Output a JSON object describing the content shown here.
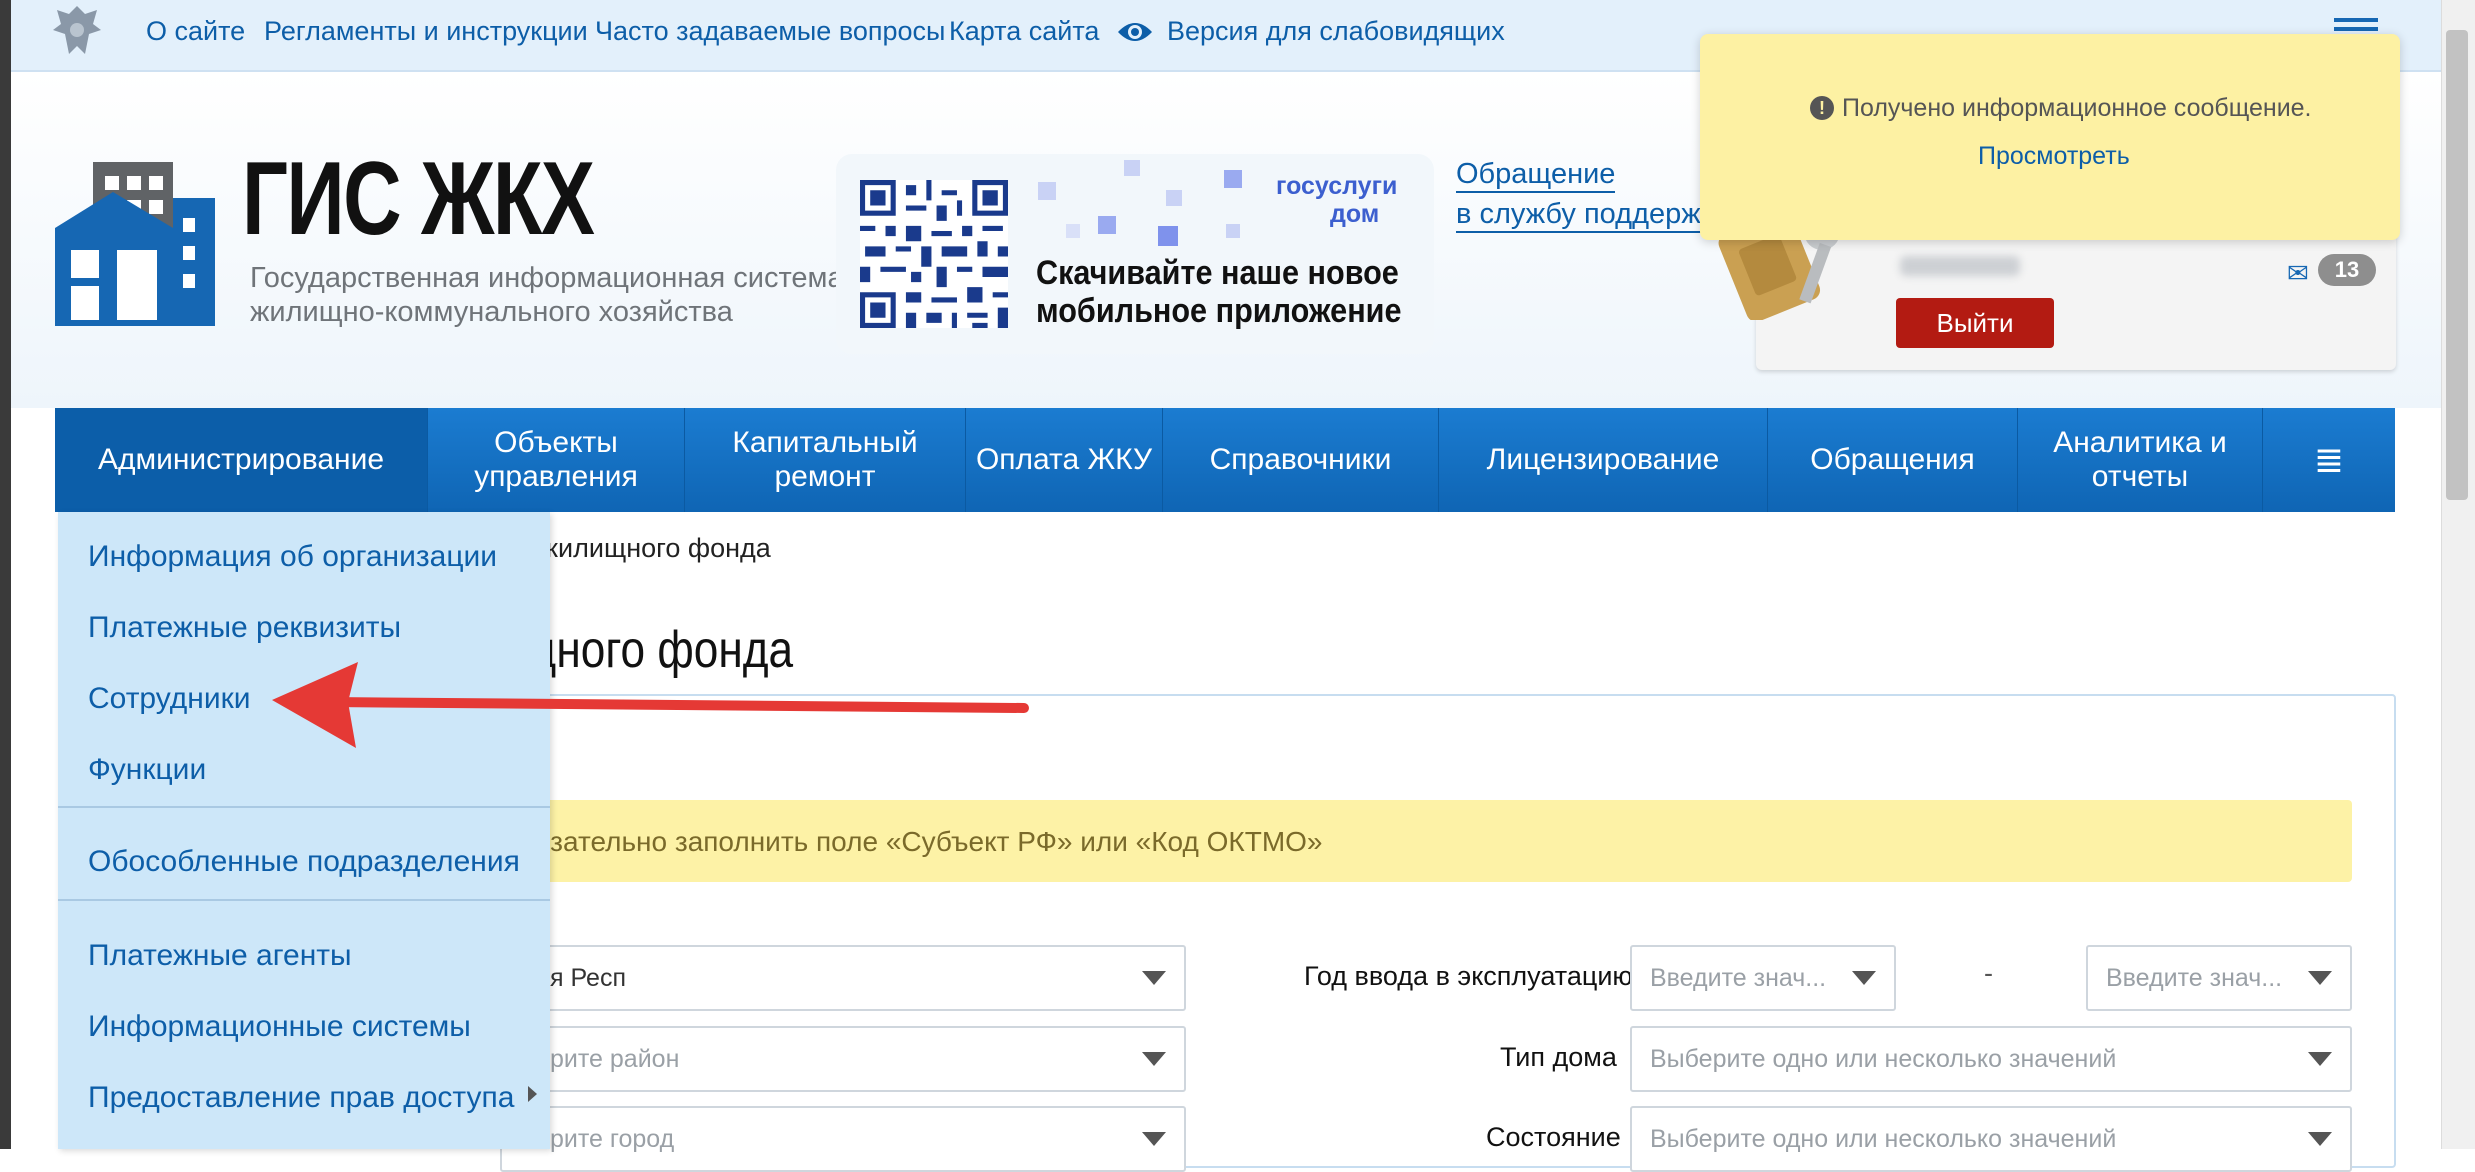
{
  "topbar": {
    "links": [
      "О сайте",
      "Регламенты и инструкции",
      "Часто задаваемые вопросы",
      "Карта сайта"
    ],
    "accessibility": "Версия для слабовидящих"
  },
  "logo": {
    "title": "ГИС ЖКХ",
    "subtitle_line1": "Государственная информационная система",
    "subtitle_line2": "жилищно-коммунального хозяйства"
  },
  "promo": {
    "brand_line1": "госуслуги",
    "brand_line2": "дом",
    "text_line1": "Скачивайте наше новое",
    "text_line2": "мобильное приложение"
  },
  "support": {
    "line1": "Обращение",
    "line2": "в службу поддержки"
  },
  "user": {
    "logout_label": "Выйти",
    "mail_count": "13"
  },
  "toast": {
    "icon": "!",
    "message": "Получено информационное сообщение.",
    "link": "Просмотреть"
  },
  "nav": {
    "items": [
      {
        "label": "Администрирование"
      },
      {
        "label": "Объекты управления"
      },
      {
        "label": "Капитальный ремонт"
      },
      {
        "label": "Оплата ЖКУ"
      },
      {
        "label": "Справочники"
      },
      {
        "label": "Лицензирование"
      },
      {
        "label": "Обращения"
      },
      {
        "label": "Аналитика и отчеты"
      }
    ],
    "menu_icon": "≣"
  },
  "dropdown": {
    "items": [
      "Информация об организации",
      "Платежные реквизиты",
      "Сотрудники",
      "Функции",
      "Обособленные подразделения",
      "Платежные агенты",
      "Информационные системы",
      "Предоставление прав доступа"
    ]
  },
  "page": {
    "breadcrumb": "жилищного фонда",
    "title": "щного фонда",
    "warning": "язательно заполнить поле «Субъект РФ» или «Код ОКТМО»",
    "fields": {
      "region_value": "я Респ",
      "district_placeholder": "рите район",
      "city_placeholder": "рите город",
      "year_label": "Год ввода в эксплуатацию",
      "year_from_placeholder": "Введите знач...",
      "year_dash": "-",
      "year_to_placeholder": "Введите знач...",
      "house_type_label": "Тип дома",
      "house_type_placeholder": "Выберите одно или несколько значений",
      "state_label": "Состояние",
      "state_placeholder": "Выберите одно или несколько значений"
    }
  },
  "colors": {
    "nav_blue": "#1570c2",
    "dropdown_bg": "#cde7f9",
    "toast_bg": "#fdf1a3",
    "logout_red": "#b31b12",
    "arrow_red": "#e53935"
  }
}
